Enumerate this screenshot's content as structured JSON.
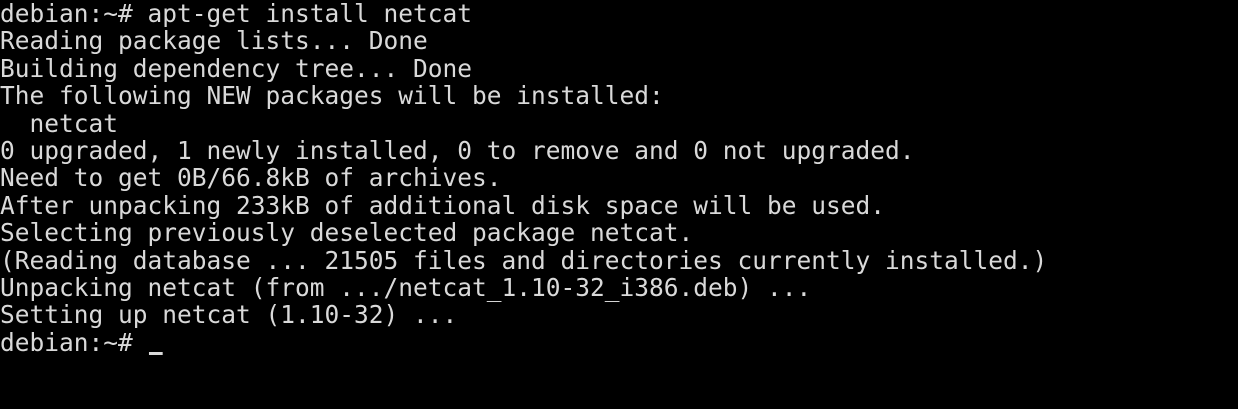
{
  "terminal": {
    "lines": [
      "debian:~# apt-get install netcat",
      "Reading package lists... Done",
      "Building dependency tree... Done",
      "The following NEW packages will be installed:",
      "  netcat",
      "0 upgraded, 1 newly installed, 0 to remove and 0 not upgraded.",
      "Need to get 0B/66.8kB of archives.",
      "After unpacking 233kB of additional disk space will be used.",
      "Selecting previously deselected package netcat.",
      "(Reading database ... 21505 files and directories currently installed.)",
      "Unpacking netcat (from .../netcat_1.10-32_i386.deb) ...",
      "Setting up netcat (1.10-32) ..."
    ],
    "prompt": "debian:~# ",
    "colors": {
      "background": "#000000",
      "foreground": "#d9d9d9"
    }
  }
}
